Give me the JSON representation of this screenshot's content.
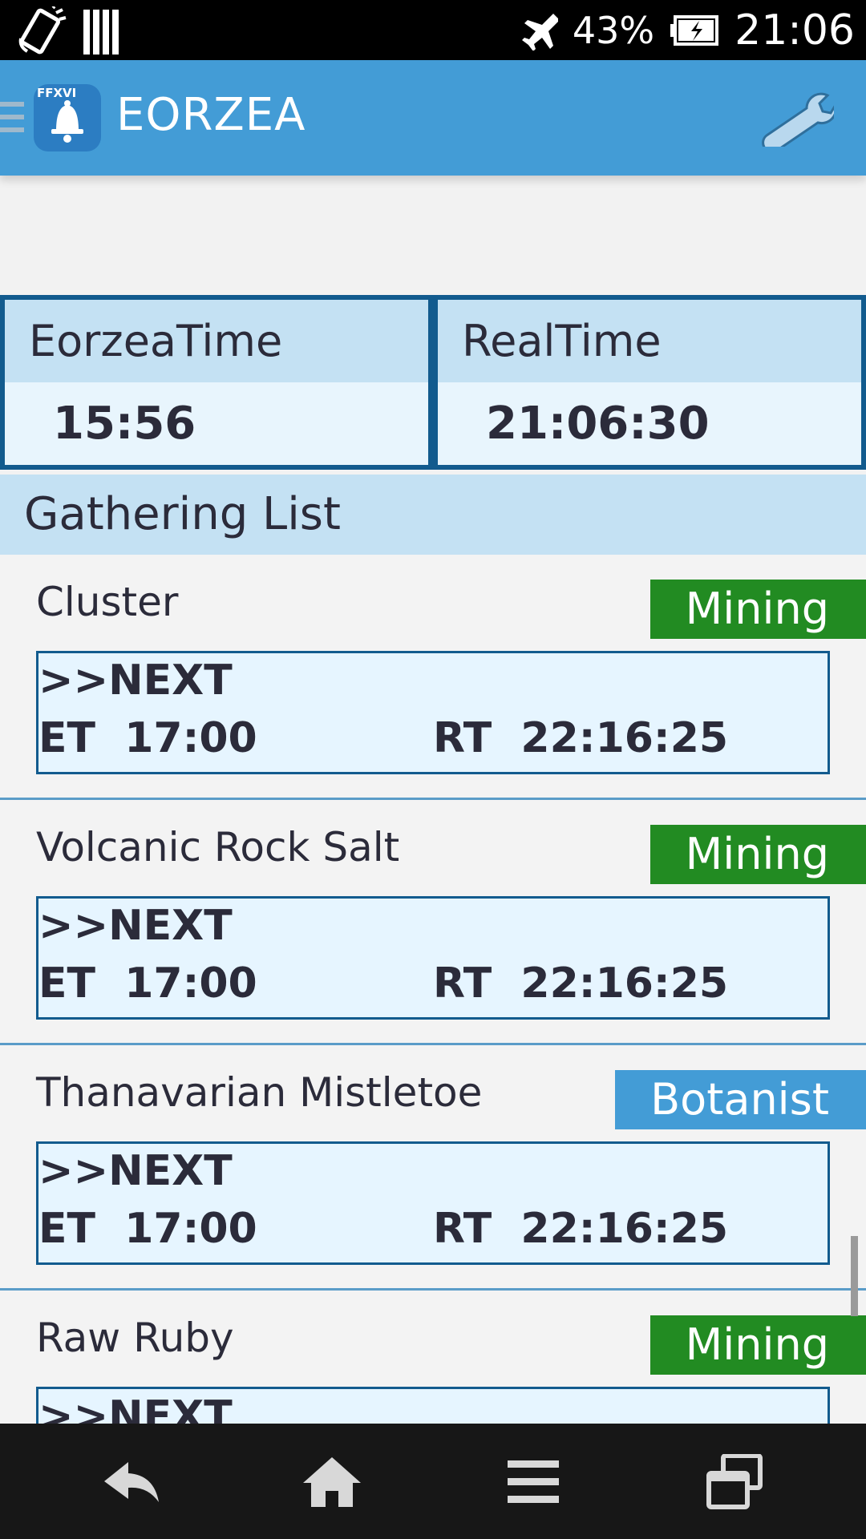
{
  "status_bar": {
    "battery": "43%",
    "time": "21:06",
    "icons": [
      "rotate-icon",
      "signal-bars-icon",
      "airplane-icon",
      "battery-charging-icon"
    ]
  },
  "app_bar": {
    "logo_text": "FFXVI",
    "title": "EORZEA",
    "icons": [
      "drawer-icon",
      "bell-logo-icon",
      "wrench-icon"
    ]
  },
  "time_panel": {
    "eorzea": {
      "label": "EorzeaTime",
      "value": "15:56"
    },
    "real": {
      "label": "RealTime",
      "value": "21:06:30"
    }
  },
  "section": {
    "title": "Gathering List"
  },
  "colors": {
    "app_bar": "#439cd6",
    "mining_badge": "#228b22",
    "botanist_badge": "#439cd6",
    "panel_header": "#c4e1f3",
    "border": "#125b8e"
  },
  "items": [
    {
      "name": "Cluster",
      "type": "Mining",
      "next": ">>NEXT",
      "et_label": "ET",
      "et": "17:00",
      "rt_label": "RT",
      "rt": "22:16:25"
    },
    {
      "name": "Volcanic Rock Salt",
      "type": "Mining",
      "next": ">>NEXT",
      "et_label": "ET",
      "et": "17:00",
      "rt_label": "RT",
      "rt": "22:16:25"
    },
    {
      "name": "Thanavarian Mistletoe",
      "type": "Botanist",
      "next": ">>NEXT",
      "et_label": "ET",
      "et": "17:00",
      "rt_label": "RT",
      "rt": "22:16:25"
    },
    {
      "name": "Raw Ruby",
      "type": "Mining",
      "next": ">>NEXT"
    }
  ],
  "nav_bar": {
    "icons": [
      "back-icon",
      "home-icon",
      "menu-icon",
      "recent-apps-icon"
    ]
  }
}
